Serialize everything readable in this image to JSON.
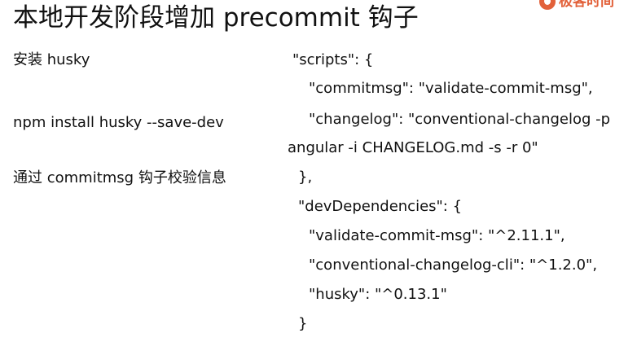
{
  "title": "本地开发阶段增加 precommit 钩子",
  "logo": {
    "text": "极客时间",
    "icon": "geektime-logo-icon",
    "color": "#e2613a"
  },
  "left_column": [
    "安装 husky",
    "npm install husky --save-dev",
    "通过 commitmsg 钩子校验信息"
  ],
  "code_lines": [
    "\"scripts\": {",
    "\"commitmsg\": \"validate-commit-msg\",",
    "\"changelog\": \"conventional-changelog -p",
    "angular -i CHANGELOG.md -s -r 0\"",
    "},",
    "\"devDependencies\": {",
    "\"validate-commit-msg\": \"^2.11.1\",",
    "\"conventional-changelog-cli\": \"^1.2.0\",",
    "\"husky\": \"^0.13.1\"",
    "}"
  ]
}
